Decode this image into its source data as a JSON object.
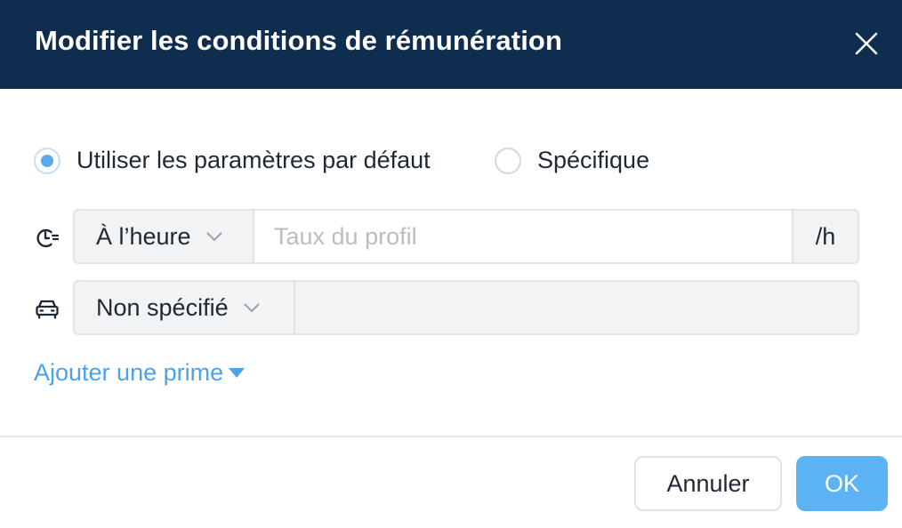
{
  "dialog": {
    "title": "Modifier les conditions de rémunération",
    "close_icon": "close-icon"
  },
  "mode": {
    "options": [
      {
        "label": "Utiliser les paramètres par défaut",
        "checked": true
      },
      {
        "label": "Spécifique",
        "checked": false
      }
    ]
  },
  "rate_row": {
    "icon": "clock-icon",
    "select_value": "À l’heure",
    "input_value": "",
    "input_placeholder": "Taux du profil",
    "suffix": "/h"
  },
  "travel_row": {
    "icon": "car-icon",
    "select_value": "Non spécifié",
    "input_value": ""
  },
  "add_bonus": {
    "label": "Ajouter une prime"
  },
  "footer": {
    "cancel_label": "Annuler",
    "ok_label": "OK"
  },
  "colors": {
    "header_bg": "#0f2d4e",
    "accent": "#5aa9ec",
    "link": "#4aa3e8",
    "ok_button": "#5cb3f3"
  }
}
